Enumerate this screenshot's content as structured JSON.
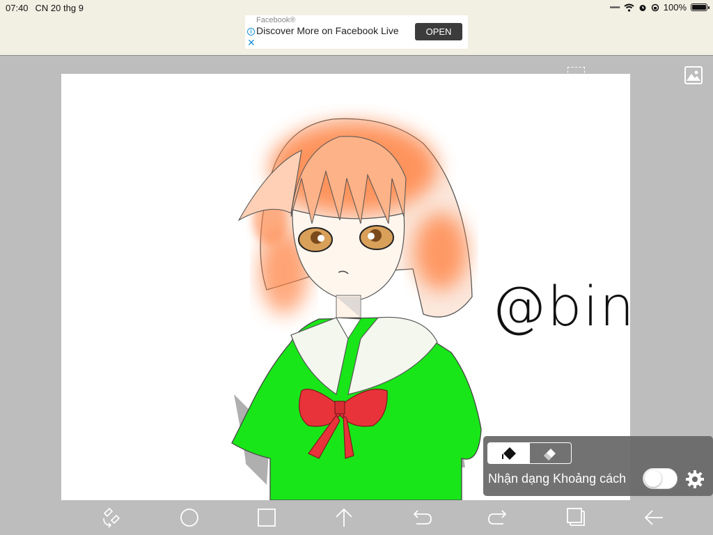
{
  "status": {
    "time": "07:40",
    "date": "CN 20 thg 9",
    "battery_percent": "100%",
    "icons": [
      "cellular-dots-icon",
      "wifi-icon",
      "alarm-icon",
      "orientation-lock-icon",
      "battery-icon"
    ]
  },
  "ad": {
    "sponsor": "Facebook®",
    "title": "Discover More on Facebook Live",
    "cta": "OPEN",
    "icons": [
      "info-icon",
      "close-icon"
    ]
  },
  "canvas": {
    "signature": "@bin",
    "colors": {
      "hair": "#ff8547",
      "shirt": "#19e619",
      "bow": "#e8333b",
      "collar": "#f3f7ee"
    }
  },
  "brush_panel": {
    "modes": [
      "brush-icon",
      "eraser-icon"
    ],
    "active_mode": "brush-icon",
    "label": "Nhận dạng Khoảng cách",
    "toggle_on": false
  },
  "toolbar": {
    "items": [
      "transform-icon",
      "circle-icon",
      "square-icon",
      "arrow-up-icon",
      "undo-icon",
      "redo-icon",
      "layers-icon",
      "back-icon"
    ]
  },
  "theme": {
    "workspace": "#bdbdbd",
    "statusbar": "#f2efe3",
    "panel": "#676767"
  }
}
